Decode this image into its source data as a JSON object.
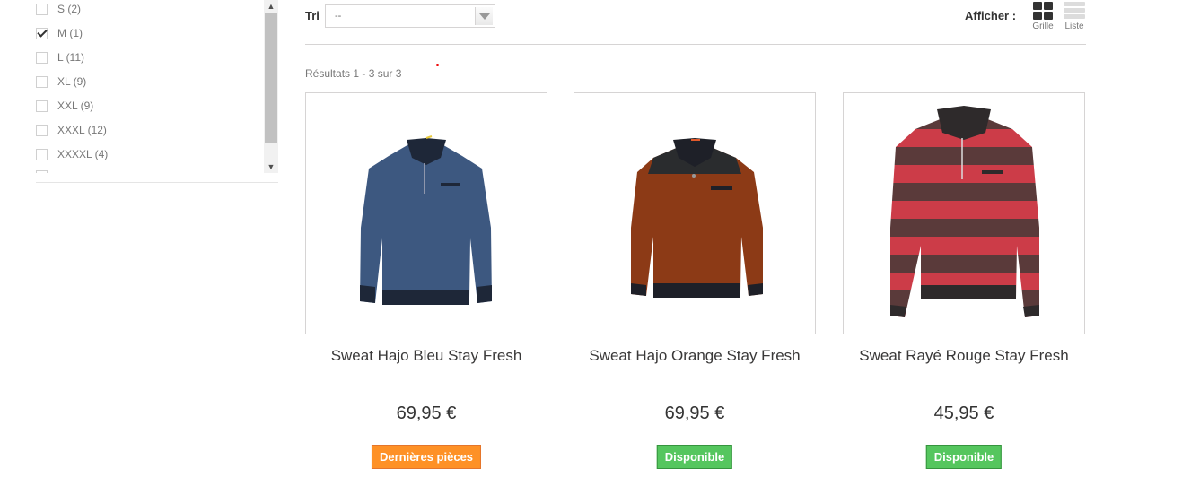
{
  "filter": {
    "items": [
      {
        "label": "S (2)",
        "checked": false
      },
      {
        "label": "M (1)",
        "checked": true
      },
      {
        "label": "L (11)",
        "checked": false
      },
      {
        "label": "XL (9)",
        "checked": false
      },
      {
        "label": "XXL (9)",
        "checked": false
      },
      {
        "label": "XXXL (12)",
        "checked": false
      },
      {
        "label": "XXXXL (4)",
        "checked": false
      }
    ]
  },
  "toolbar": {
    "sort_label": "Tri",
    "sort_value": "--",
    "display_label": "Afficher :",
    "grid_label": "Grille",
    "list_label": "Liste"
  },
  "results_text": "Résultats 1 - 3 sur 3",
  "products": [
    {
      "name": "Sweat Hajo Bleu Stay Fresh",
      "price": "69,95 €",
      "availability": "Dernières pièces",
      "availability_color": "#fe9126"
    },
    {
      "name": "Sweat Hajo Orange Stay Fresh",
      "price": "69,95 €",
      "availability": "Disponible",
      "availability_color": "#55c65e"
    },
    {
      "name": "Sweat Rayé Rouge Stay Fresh",
      "price": "45,95 €",
      "availability": "Disponible",
      "availability_color": "#55c65e"
    }
  ]
}
